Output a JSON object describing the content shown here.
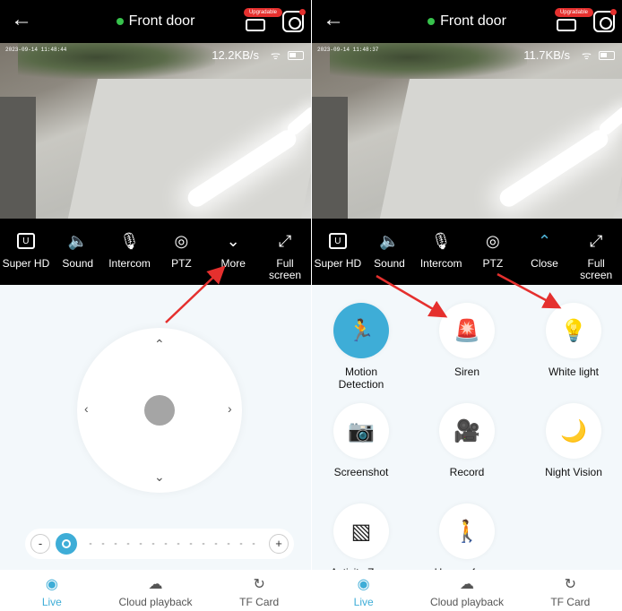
{
  "left": {
    "title": "Front door",
    "upgrade_badge": "Upgradable",
    "timestamp": "2023-09-14 11:48:44",
    "speed": "12.2KB/s",
    "toolbar": [
      {
        "icon": "hd-icon",
        "glyph": "U",
        "label": "Super HD"
      },
      {
        "icon": "mute-icon",
        "glyph": "🔈",
        "label": "Sound"
      },
      {
        "icon": "microphone-icon",
        "glyph": "🎙",
        "label": "Intercom"
      },
      {
        "icon": "ptz-icon",
        "glyph": "◎",
        "label": "PTZ"
      },
      {
        "icon": "chevron-down-icon",
        "glyph": "⌄",
        "label": "More"
      },
      {
        "icon": "fullscreen-icon",
        "glyph": "⤢",
        "label": "Full screen"
      }
    ],
    "slider": {
      "minus": "-",
      "plus": "+"
    }
  },
  "right": {
    "title": "Front door",
    "upgrade_badge": "Upgradable",
    "timestamp": "2023-09-14 11:48:37",
    "speed": "11.7KB/s",
    "toolbar": [
      {
        "icon": "hd-icon",
        "glyph": "U",
        "label": "Super HD"
      },
      {
        "icon": "mute-icon",
        "glyph": "🔈",
        "label": "Sound"
      },
      {
        "icon": "microphone-icon",
        "glyph": "🎙",
        "label": "Intercom"
      },
      {
        "icon": "ptz-icon",
        "glyph": "◎",
        "label": "PTZ"
      },
      {
        "icon": "chevron-up-icon",
        "glyph": "⌃",
        "label": "Close"
      },
      {
        "icon": "fullscreen-icon",
        "glyph": "⤢",
        "label": "Full screen"
      }
    ],
    "features": [
      {
        "name": "motion-detection",
        "icon": "running-person-icon",
        "glyph": "🏃",
        "label": "Motion Detection",
        "active": true
      },
      {
        "name": "siren",
        "icon": "siren-icon",
        "glyph": "🚨",
        "label": "Siren",
        "active": false
      },
      {
        "name": "white-light",
        "icon": "light-icon",
        "glyph": "💡",
        "label": "White light",
        "active": false
      },
      {
        "name": "screenshot",
        "icon": "camera-icon",
        "glyph": "📷",
        "label": "Screenshot",
        "active": false
      },
      {
        "name": "record",
        "icon": "video-record-icon",
        "glyph": "🎥",
        "label": "Record",
        "active": false
      },
      {
        "name": "night-vision",
        "icon": "night-vision-icon",
        "glyph": "🌙",
        "label": "Night Vision",
        "active": false
      },
      {
        "name": "activity-zone",
        "icon": "zone-icon",
        "glyph": "▧",
        "label": "Activity Zone",
        "active": false
      },
      {
        "name": "human-frame",
        "icon": "human-frame-icon",
        "glyph": "🚶",
        "label": "Human frame",
        "active": false
      }
    ]
  },
  "bottom_tabs": [
    {
      "label": "Live",
      "icon": "eye-icon",
      "glyph": "◉",
      "active": true
    },
    {
      "label": "Cloud playback",
      "icon": "cloud-icon",
      "glyph": "☁",
      "active": false
    },
    {
      "label": "TF Card",
      "icon": "tf-card-icon",
      "glyph": "↻",
      "active": false
    }
  ],
  "colors": {
    "accent": "#3eadd7",
    "online": "#37c24c",
    "annotation_arrow": "#e5302e"
  }
}
